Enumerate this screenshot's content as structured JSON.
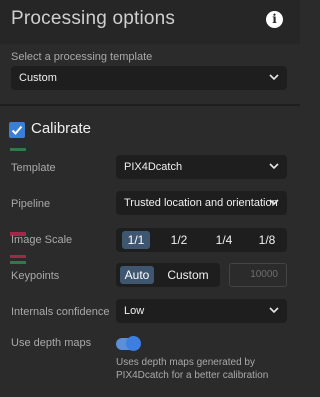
{
  "header": {
    "title": "Processing options",
    "info_icon": "info-icon"
  },
  "template_select": {
    "label": "Select a processing template",
    "value": "Custom"
  },
  "calibrate": {
    "title": "Calibrate",
    "checked": true,
    "template": {
      "label": "Template",
      "value": "PIX4Dcatch"
    },
    "pipeline": {
      "label": "Pipeline",
      "value": "Trusted location and orientation"
    },
    "image_scale": {
      "label": "Image Scale",
      "options": [
        "1/1",
        "1/2",
        "1/4",
        "1/8"
      ],
      "selected": "1/1"
    },
    "keypoints": {
      "label": "Keypoints",
      "options": [
        "Auto",
        "Custom"
      ],
      "selected": "Auto",
      "custom_value": "10000"
    },
    "internals_confidence": {
      "label": "Internals confidence",
      "value": "Low"
    },
    "depth_maps": {
      "label": "Use depth maps",
      "enabled": true,
      "description": "Uses depth maps generated by PIX4Dcatch for a better calibration"
    }
  },
  "colors": {
    "background": "#2b2b2b",
    "field": "#1e1e1e",
    "accent": "#3b7ed6",
    "selected_segment": "#3f5670"
  }
}
